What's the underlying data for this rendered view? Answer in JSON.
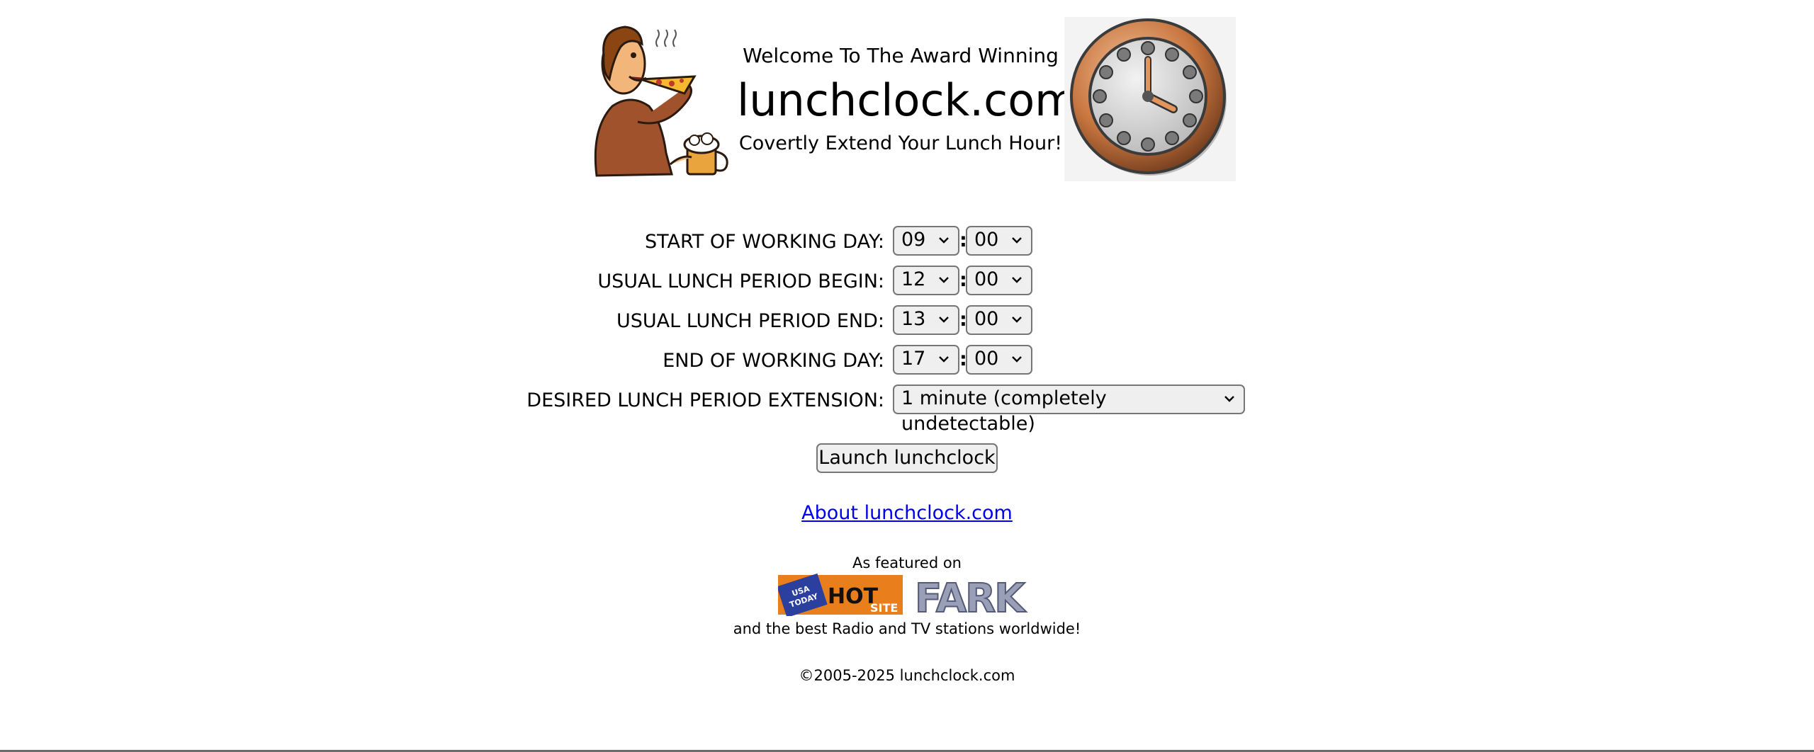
{
  "header": {
    "welcome": "Welcome To The Award Winning",
    "title": "lunchclock.com",
    "tagline": "Covertly Extend Your Lunch Hour!"
  },
  "form": {
    "start_label": "START OF WORKING DAY:",
    "start_hour": "09",
    "start_minute": "00",
    "lunch_begin_label": "USUAL LUNCH PERIOD BEGIN:",
    "lunch_begin_hour": "12",
    "lunch_begin_minute": "00",
    "lunch_end_label": "USUAL LUNCH PERIOD END:",
    "lunch_end_hour": "13",
    "lunch_end_minute": "00",
    "end_label": "END OF WORKING DAY:",
    "end_hour": "17",
    "end_minute": "00",
    "extension_label": "DESIRED LUNCH PERIOD EXTENSION:",
    "extension_value": "1 minute (completely undetectable)",
    "separator": ":",
    "launch_label": "Launch lunchclock"
  },
  "footer": {
    "about_link": "About lunchclock.com",
    "featured_label": "As featured on",
    "logo_usa_today_text": "USA TODAY",
    "logo_hot_site_text": "HOT SITE",
    "logo_fark_text": "FARK",
    "worldwide_text": "and the best Radio and TV stations worldwide!",
    "copyright": "©2005-2025 lunchclock.com"
  },
  "icons": {
    "select_arrow": "chevron-down-icon",
    "mascot": "pizza-eater-illustration",
    "clock": "wall-clock-illustration"
  }
}
